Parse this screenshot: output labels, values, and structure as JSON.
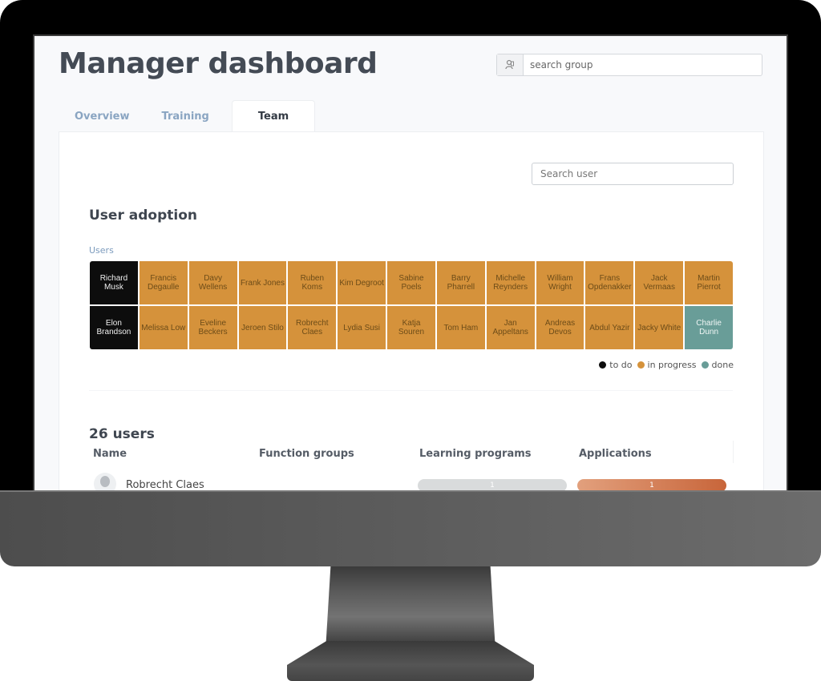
{
  "header": {
    "title": "Manager dashboard",
    "group_search": {
      "placeholder": "search group",
      "icon": "group-search-icon"
    }
  },
  "tabs": [
    {
      "label": "Overview",
      "active": false
    },
    {
      "label": "Training",
      "active": false
    },
    {
      "label": "Team",
      "active": true
    }
  ],
  "team": {
    "user_search": {
      "placeholder": "Search user"
    },
    "adoption": {
      "title": "User adoption",
      "axis_label": "Users",
      "status_colors": {
        "todo": "#0d0d0d",
        "in_progress": "#d5923b",
        "done": "#699d98"
      },
      "rows": [
        [
          {
            "name": "Richard Musk",
            "status": "todo"
          },
          {
            "name": "Francis Degaulle",
            "status": "in_progress"
          },
          {
            "name": "Davy Wellens",
            "status": "in_progress"
          },
          {
            "name": "Frank Jones",
            "status": "in_progress"
          },
          {
            "name": "Ruben Koms",
            "status": "in_progress"
          },
          {
            "name": "Kim Degroot",
            "status": "in_progress"
          },
          {
            "name": "Sabine Poels",
            "status": "in_progress"
          },
          {
            "name": "Barry Pharrell",
            "status": "in_progress"
          },
          {
            "name": "Michelle Reynders",
            "status": "in_progress"
          },
          {
            "name": "William Wright",
            "status": "in_progress"
          },
          {
            "name": "Frans Opdenakker",
            "status": "in_progress"
          },
          {
            "name": "Jack Vermaas",
            "status": "in_progress"
          },
          {
            "name": "Martin Pierrot",
            "status": "in_progress"
          }
        ],
        [
          {
            "name": "Elon Brandson",
            "status": "todo"
          },
          {
            "name": "Melissa Low",
            "status": "in_progress"
          },
          {
            "name": "Eveline Beckers",
            "status": "in_progress"
          },
          {
            "name": "Jeroen Stilo",
            "status": "in_progress"
          },
          {
            "name": "Robrecht Claes",
            "status": "in_progress"
          },
          {
            "name": "Lydia Susi",
            "status": "in_progress"
          },
          {
            "name": "Katja Souren",
            "status": "in_progress"
          },
          {
            "name": "Tom Ham",
            "status": "in_progress"
          },
          {
            "name": "Jan Appeltans",
            "status": "in_progress"
          },
          {
            "name": "Andreas Devos",
            "status": "in_progress"
          },
          {
            "name": "Abdul Yazir",
            "status": "in_progress"
          },
          {
            "name": "Jacky White",
            "status": "in_progress"
          },
          {
            "name": "Charlie Dunn",
            "status": "done"
          }
        ]
      ],
      "legend": [
        {
          "label": "to do",
          "status": "todo"
        },
        {
          "label": "in progress",
          "status": "in_progress"
        },
        {
          "label": "done",
          "status": "done"
        }
      ]
    },
    "users_table": {
      "count_label": "26 users",
      "columns": [
        "Name",
        "Function groups",
        "Learning programs",
        "Applications"
      ],
      "rows": [
        {
          "name": "Robrecht Claes",
          "function_groups": "",
          "learning_programs": "1",
          "applications": "1"
        }
      ]
    }
  }
}
